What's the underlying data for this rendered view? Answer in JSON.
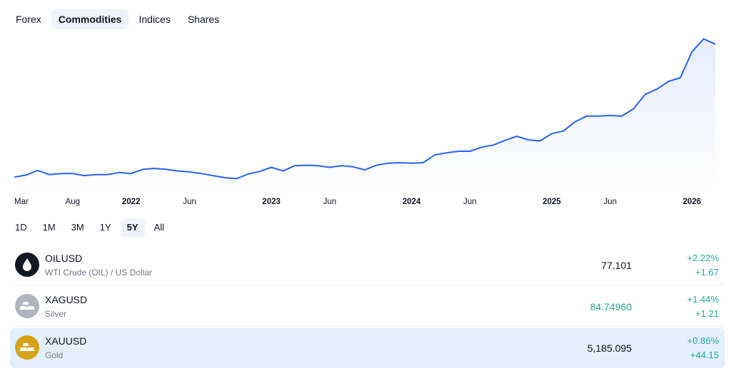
{
  "tabs": [
    {
      "label": "Forex",
      "active": false
    },
    {
      "label": "Commodities",
      "active": true
    },
    {
      "label": "Indices",
      "active": false
    },
    {
      "label": "Shares",
      "active": false
    }
  ],
  "ranges": [
    {
      "label": "1D",
      "active": false
    },
    {
      "label": "1M",
      "active": false
    },
    {
      "label": "3M",
      "active": false
    },
    {
      "label": "1Y",
      "active": false
    },
    {
      "label": "5Y",
      "active": true
    },
    {
      "label": "All",
      "active": false
    }
  ],
  "chart_data": {
    "type": "area",
    "x_labels": [
      {
        "label": "Mar",
        "index": 0,
        "year": false
      },
      {
        "label": "Aug",
        "index": 5,
        "year": false
      },
      {
        "label": "2022",
        "index": 10,
        "year": true
      },
      {
        "label": "Jun",
        "index": 15,
        "year": false
      },
      {
        "label": "2023",
        "index": 22,
        "year": true
      },
      {
        "label": "Jun",
        "index": 27,
        "year": false
      },
      {
        "label": "2024",
        "index": 34,
        "year": true
      },
      {
        "label": "Jun",
        "index": 39,
        "year": false
      },
      {
        "label": "2025",
        "index": 46,
        "year": true
      },
      {
        "label": "Jun",
        "index": 51,
        "year": false
      },
      {
        "label": "2026",
        "index": 58,
        "year": true
      }
    ],
    "series": [
      {
        "values": [
          1730,
          1770,
          1860,
          1780,
          1800,
          1800,
          1760,
          1780,
          1780,
          1820,
          1800,
          1880,
          1900,
          1880,
          1850,
          1830,
          1800,
          1760,
          1720,
          1700,
          1790,
          1840,
          1920,
          1850,
          1950,
          1960,
          1950,
          1920,
          1950,
          1930,
          1870,
          1960,
          2000,
          2010,
          2000,
          2010,
          2160,
          2200,
          2230,
          2230,
          2310,
          2350,
          2440,
          2520,
          2450,
          2430,
          2570,
          2620,
          2800,
          2910,
          2910,
          2920,
          2910,
          3050,
          3330,
          3430,
          3580,
          3650,
          4150,
          4400,
          4300
        ],
        "color": "#2962ff"
      }
    ],
    "ylim": [
      1500,
      4600
    ],
    "grid": false,
    "legend": "none"
  },
  "rows": [
    {
      "symbol": "OILUSD",
      "desc": "WTI Crude (OIL) / US Dollar",
      "price": "77.101",
      "price_up": false,
      "change_pct": "+2.22%",
      "change_abs": "+1.67",
      "logo_icon": "oil-drop-icon",
      "logo_bg": "#131722",
      "selected": false
    },
    {
      "symbol": "XAGUSD",
      "desc": "Silver",
      "price": "84.74960",
      "price_up": true,
      "change_pct": "+1.44%",
      "change_abs": "+1.21",
      "logo_icon": "silver-bars-icon",
      "logo_bg": "#b2b5be",
      "selected": false
    },
    {
      "symbol": "XAUUSD",
      "desc": "Gold",
      "price": "5,185.095",
      "price_up": false,
      "change_pct": "+0.86%",
      "change_abs": "+44.15",
      "logo_icon": "gold-bars-icon",
      "logo_bg": "#d9a21b",
      "selected": true
    }
  ],
  "colors": {
    "accent": "#2962ff",
    "positive": "#22ab94",
    "selected_row": "#e3effd"
  }
}
